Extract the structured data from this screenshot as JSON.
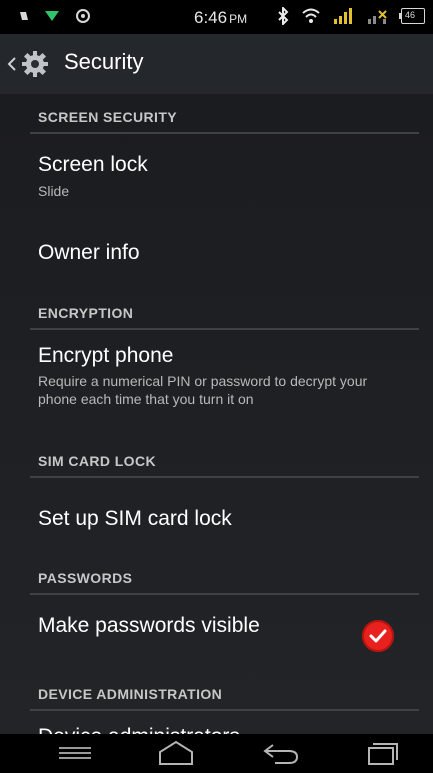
{
  "status_bar": {
    "time": "6:46",
    "ampm": "PM",
    "icons": [
      "silent-mode-icon",
      "wifi-triangle-icon",
      "voicemail-icon",
      "bluetooth-icon",
      "wifi-icon",
      "signal-icon",
      "data-signal-icon",
      "battery-icon"
    ],
    "battery_label": "46"
  },
  "action_bar": {
    "title": "Security"
  },
  "sections": {
    "screen_security": "SCREEN SECURITY",
    "encryption": "ENCRYPTION",
    "sim_card_lock": "SIM CARD LOCK",
    "passwords": "PASSWORDS",
    "device_admin": "DEVICE ADMINISTRATION"
  },
  "items": {
    "screen_lock": {
      "title": "Screen lock",
      "summary": "Slide"
    },
    "owner_info": {
      "title": "Owner info"
    },
    "encrypt_phone": {
      "title": "Encrypt phone",
      "summary": "Require a numerical PIN or password to decrypt your phone each time that you turn it on"
    },
    "sim_lock": {
      "title": "Set up SIM card lock"
    },
    "make_passwords_visible": {
      "title": "Make passwords visible",
      "checked": true
    },
    "device_administrators": {
      "title": "Device administrators"
    }
  },
  "colors": {
    "accent_check": "#e8211f",
    "background": "#1b1d20",
    "action_bar": "#24272b"
  },
  "nav_bar": {
    "buttons": [
      "recent-apps-icon",
      "home-icon",
      "back-icon",
      "overview-icon"
    ]
  }
}
